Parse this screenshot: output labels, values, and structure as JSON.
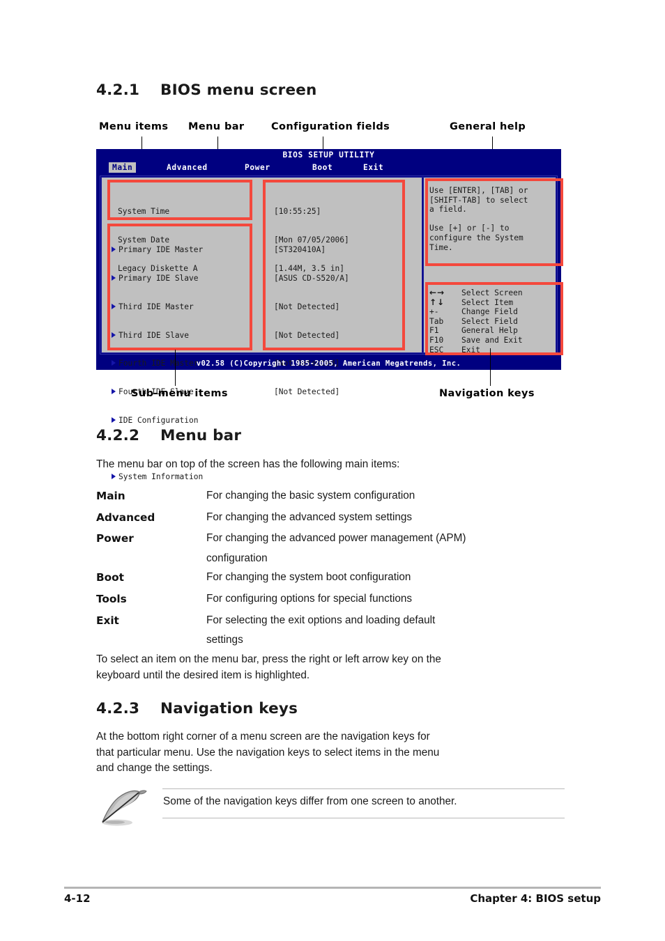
{
  "sections": {
    "s421": {
      "number": "4.2.1",
      "title": "BIOS menu screen"
    },
    "s422": {
      "number": "4.2.2",
      "title": "Menu bar"
    },
    "s423": {
      "number": "4.2.3",
      "title": "Navigation keys"
    }
  },
  "callouts": {
    "menu_items": "Menu items",
    "menu_bar": "Menu bar",
    "configuration_fields": "Configuration fields",
    "general_help": "General help",
    "sub_menu_items": "Sub-menu items",
    "navigation_keys": "Navigation keys"
  },
  "bios": {
    "title": "BIOS SETUP UTILITY",
    "tabs": [
      {
        "label": "Main",
        "active": true
      },
      {
        "label": "Advanced",
        "active": false
      },
      {
        "label": "Power",
        "active": false
      },
      {
        "label": "Boot",
        "active": false
      },
      {
        "label": "Exit",
        "active": false
      }
    ],
    "settings": [
      {
        "label": "System Time",
        "value": "[10:55:25]"
      },
      {
        "label": "System Date",
        "value": "[Mon 07/05/2006]"
      },
      {
        "label": "Legacy Diskette A",
        "value": "[1.44M, 3.5 in]"
      }
    ],
    "submenus": [
      {
        "label": "Primary IDE Master",
        "value": "[ST320410A]"
      },
      {
        "label": "Primary IDE Slave",
        "value": "[ASUS CD-S520/A]"
      },
      {
        "label": "Third IDE Master",
        "value": "[Not Detected]"
      },
      {
        "label": "Third IDE Slave",
        "value": "[Not Detected]"
      },
      {
        "label": "Fourth IDE Master",
        "value": "[Not Detected]"
      },
      {
        "label": "Fourth IDE Slave",
        "value": "[Not Detected]"
      },
      {
        "label": "IDE Configuration",
        "value": ""
      }
    ],
    "submenus_extra": [
      {
        "label": "System Information",
        "value": ""
      }
    ],
    "help_paragraph_1": "Use [ENTER], [TAB] or\n[SHIFT-TAB] to select\na field.",
    "help_paragraph_2": "Use [+] or [-] to\nconfigure the System\nTime.",
    "nav_keys": [
      {
        "key": "←→",
        "desc": "Select Screen"
      },
      {
        "key": "↑↓",
        "desc": "Select Item"
      },
      {
        "key": "+-",
        "desc": "Change Field"
      },
      {
        "key": "Tab",
        "desc": "Select Field"
      },
      {
        "key": "F1",
        "desc": "General Help"
      },
      {
        "key": "F10",
        "desc": "Save and Exit"
      },
      {
        "key": "ESC",
        "desc": "Exit"
      }
    ],
    "footer": "v02.58 (C)Copyright 1985-2005, American Megatrends, Inc.",
    "colors": {
      "screen_bg": "#000080",
      "panel_bg": "#c0c0c0",
      "highlight_red": "#f4483c",
      "active_tab_bg": "#c0c0c0",
      "active_tab_text": "#000080",
      "triangle_blue": "#1515a8"
    }
  },
  "menu_bar_section": {
    "intro": "The menu bar on top of the screen has the following main items:",
    "items": [
      {
        "term": "Main",
        "desc": "For changing the basic system configuration",
        "desc2": ""
      },
      {
        "term": "Advanced",
        "desc": "For changing the advanced system settings",
        "desc2": ""
      },
      {
        "term": "Power",
        "desc": "For changing the advanced power management (APM)",
        "desc2": "configuration"
      },
      {
        "term": "Boot",
        "desc": "For changing the system boot configuration",
        "desc2": ""
      },
      {
        "term": "Tools",
        "desc": "For configuring options for special functions",
        "desc2": ""
      },
      {
        "term": "Exit",
        "desc": "For selecting the exit options and loading default",
        "desc2": "settings"
      }
    ],
    "outro_line1": "To select an item on the menu bar, press the right or left arrow key on the",
    "outro_line2": "keyboard until the desired item is highlighted."
  },
  "navigation_keys_section": {
    "line1": "At the bottom right corner of a menu screen are the navigation keys for",
    "line2": "that particular menu. Use the navigation keys to select items in the menu",
    "line3": "and change the settings."
  },
  "note": {
    "text": "Some of the navigation keys differ from one screen to another."
  },
  "page_footer": {
    "page_number": "4-12",
    "chapter": "Chapter 4: BIOS setup"
  }
}
